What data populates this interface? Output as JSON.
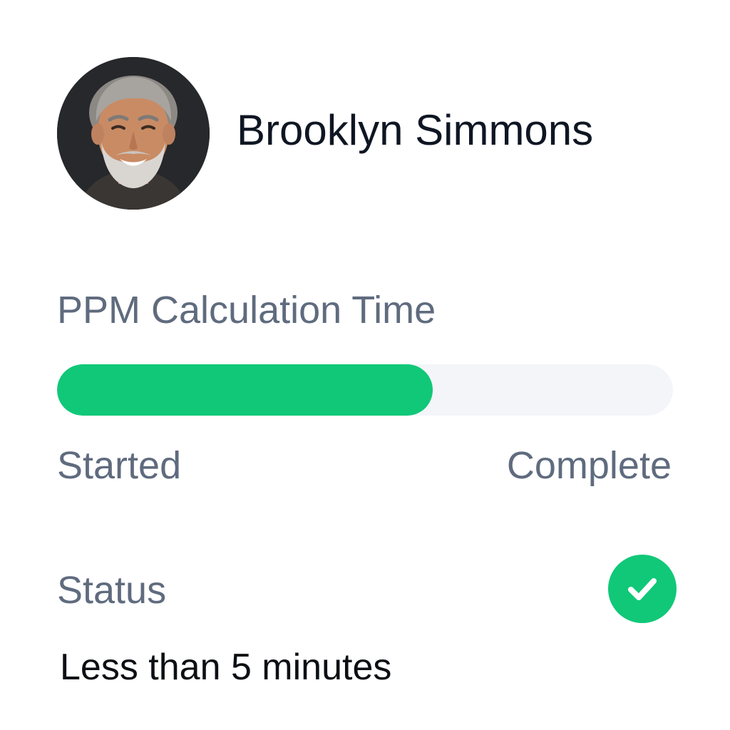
{
  "user": {
    "name": "Brooklyn Simmons",
    "avatar_icon": "user-photo"
  },
  "metric": {
    "title": "PPM Calculation Time",
    "progress_fraction": 0.61,
    "start_label": "Started",
    "end_label": "Complete"
  },
  "status": {
    "label": "Status",
    "icon": "check-circle-icon",
    "value": "Less than 5 minutes"
  },
  "colors": {
    "accent": "#10c878",
    "track": "#f3f5f8",
    "muted_text": "#5f6b7e",
    "primary_text": "#0f1623"
  }
}
